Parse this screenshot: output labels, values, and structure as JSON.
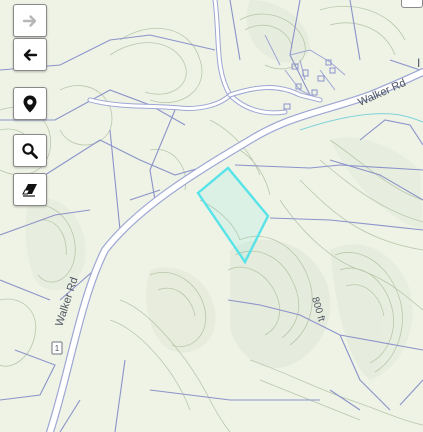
{
  "map": {
    "labels": {
      "road_east": "Walker Rd",
      "road_west": "Walker Rd",
      "elevation": "800 ft",
      "route_shield": "1",
      "edge_letter": "I"
    },
    "colors": {
      "terrain": "#eef3e6",
      "contour": "#b9c7aa",
      "parcel_line": "#8c93c9",
      "road_fill": "#ffffff",
      "road_casing": "#9ea6d3",
      "highlight": "#58e3e8",
      "water": "#7fd3d8"
    }
  },
  "toolbar": {
    "tools": [
      {
        "name": "forward",
        "icon": "arrow-right-icon",
        "disabled": true
      },
      {
        "name": "back",
        "icon": "arrow-left-icon",
        "disabled": false
      },
      {
        "name": "locate",
        "icon": "map-pin-icon",
        "disabled": false
      },
      {
        "name": "search",
        "icon": "magnifier-icon",
        "disabled": false
      },
      {
        "name": "erase",
        "icon": "eraser-icon",
        "disabled": false
      }
    ]
  }
}
